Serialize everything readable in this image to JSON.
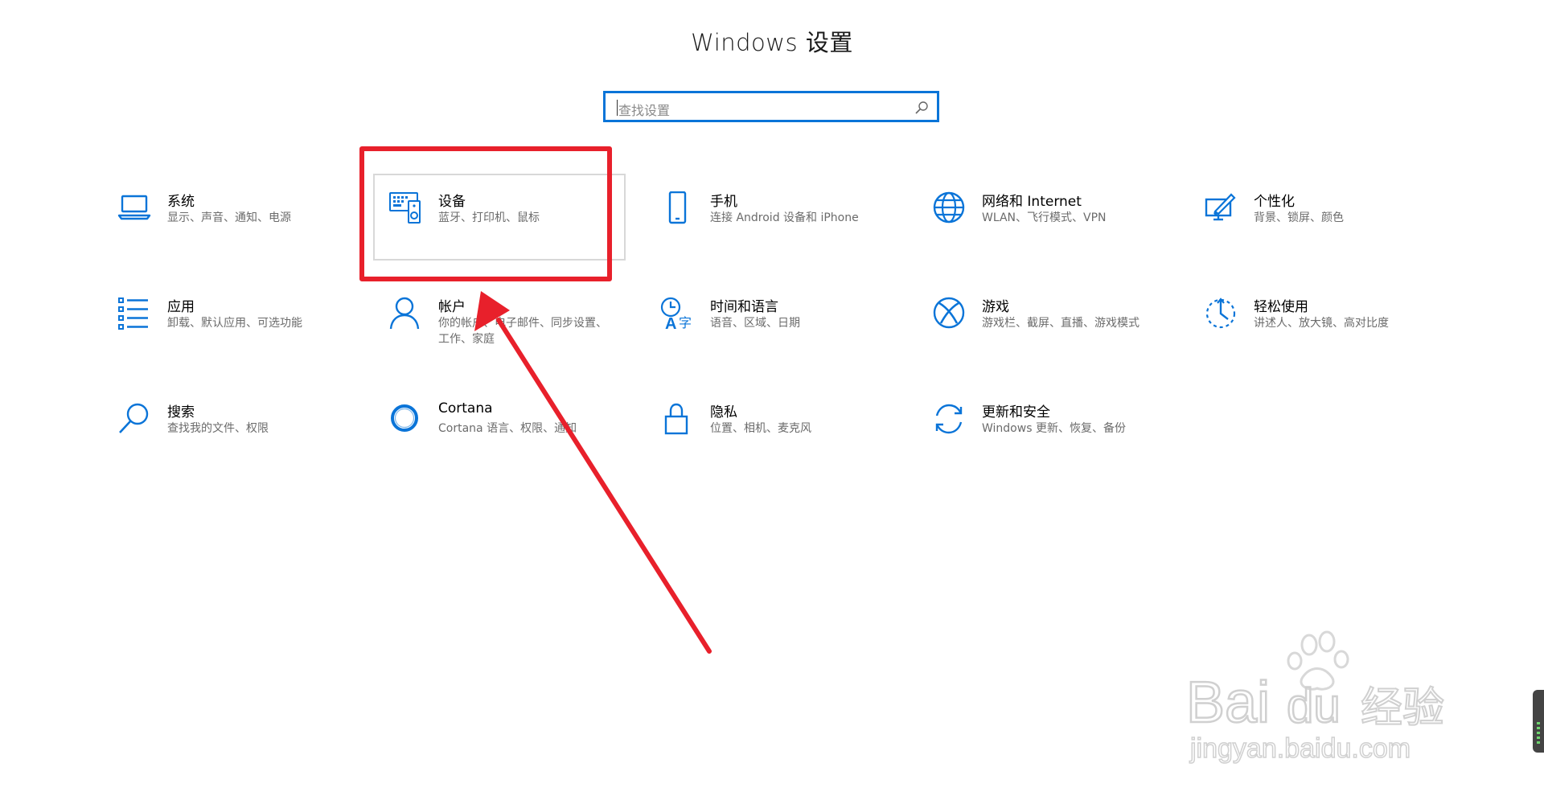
{
  "window": {
    "title": "Windows 设置"
  },
  "search": {
    "placeholder": "查找设置"
  },
  "colors": {
    "accent": "#0a74d8",
    "annotation": "#e8202b"
  },
  "tiles": [
    {
      "name": "系统",
      "desc": "显示、声音、通知、电源",
      "icon": "laptop-icon"
    },
    {
      "name": "设备",
      "desc": "蓝牙、打印机、鼠标",
      "icon": "devices-icon"
    },
    {
      "name": "手机",
      "desc": "连接 Android 设备和 iPhone",
      "icon": "phone-icon"
    },
    {
      "name": "网络和 Internet",
      "desc": "WLAN、飞行模式、VPN",
      "icon": "globe-icon"
    },
    {
      "name": "个性化",
      "desc": "背景、锁屏、颜色",
      "icon": "personalization-icon"
    },
    {
      "name": "应用",
      "desc": "卸载、默认应用、可选功能",
      "icon": "apps-list-icon"
    },
    {
      "name": "帐户",
      "desc": "你的帐户、电子邮件、同步设置、工作、家庭",
      "icon": "person-icon"
    },
    {
      "name": "时间和语言",
      "desc": "语音、区域、日期",
      "icon": "time-language-icon"
    },
    {
      "name": "游戏",
      "desc": "游戏栏、截屏、直播、游戏模式",
      "icon": "xbox-icon"
    },
    {
      "name": "轻松使用",
      "desc": "讲述人、放大镜、高对比度",
      "icon": "ease-of-access-icon"
    },
    {
      "name": "搜索",
      "desc": "查找我的文件、权限",
      "icon": "search-icon"
    },
    {
      "name": "Cortana",
      "desc": "Cortana 语言、权限、通知",
      "icon": "cortana-icon"
    },
    {
      "name": "隐私",
      "desc": "位置、相机、麦克风",
      "icon": "lock-icon"
    },
    {
      "name": "更新和安全",
      "desc": "Windows 更新、恢复、备份",
      "icon": "update-icon"
    }
  ],
  "watermark": {
    "logo_text": "Bai du 经验",
    "url": "jingyan.baidu.com"
  }
}
